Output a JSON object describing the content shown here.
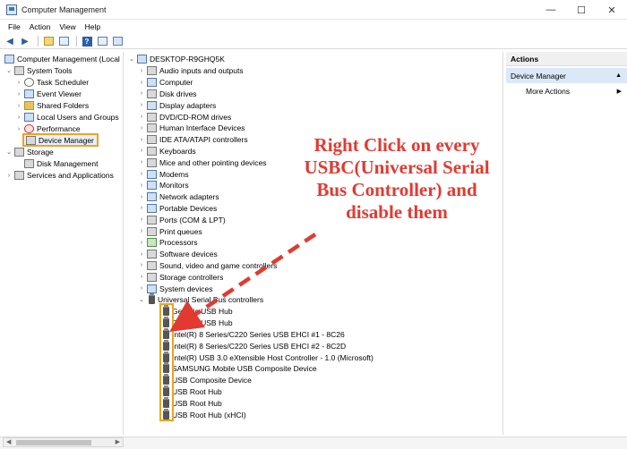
{
  "window": {
    "title": "Computer Management",
    "controls": {
      "minimize": "—",
      "maximize": "☐",
      "close": "✕"
    }
  },
  "menu": [
    "File",
    "Action",
    "View",
    "Help"
  ],
  "left_tree": {
    "root": "Computer Management (Local",
    "system_tools": "System Tools",
    "task_scheduler": "Task Scheduler",
    "event_viewer": "Event Viewer",
    "shared_folders": "Shared Folders",
    "local_users": "Local Users and Groups",
    "performance": "Performance",
    "device_manager": "Device Manager",
    "storage": "Storage",
    "disk_management": "Disk Management",
    "services": "Services and Applications"
  },
  "device_tree": {
    "computer_name": "DESKTOP-R9GHQ5K",
    "categories": [
      "Audio inputs and outputs",
      "Computer",
      "Disk drives",
      "Display adapters",
      "DVD/CD-ROM drives",
      "Human Interface Devices",
      "IDE ATA/ATAPI controllers",
      "Keyboards",
      "Mice and other pointing devices",
      "Modems",
      "Monitors",
      "Network adapters",
      "Portable Devices",
      "Ports (COM & LPT)",
      "Print queues",
      "Processors",
      "Software devices",
      "Sound, video and game controllers",
      "Storage controllers",
      "System devices",
      "Universal Serial Bus controllers"
    ],
    "usb_devices": [
      "Generic USB Hub",
      "Generic USB Hub",
      "Intel(R) 8 Series/C220 Series  USB EHCI #1 - 8C26",
      "Intel(R) 8 Series/C220 Series  USB EHCI #2 - 8C2D",
      "Intel(R) USB 3.0 eXtensible Host Controller - 1.0 (Microsoft)",
      "SAMSUNG Mobile USB Composite Device",
      "USB Composite Device",
      "USB Root Hub",
      "USB Root Hub",
      "USB Root Hub (xHCI)"
    ]
  },
  "actions": {
    "header": "Actions",
    "section": "Device Manager",
    "more": "More Actions"
  },
  "annotation": {
    "line1": "Right Click on every",
    "line2": "USBC(Universal Serial",
    "line3": "Bus Controller) and",
    "line4": "disable them",
    "color": "#e23a32"
  },
  "colors": {
    "highlight": "#f0a31f",
    "selection": "#dbe8f7"
  }
}
